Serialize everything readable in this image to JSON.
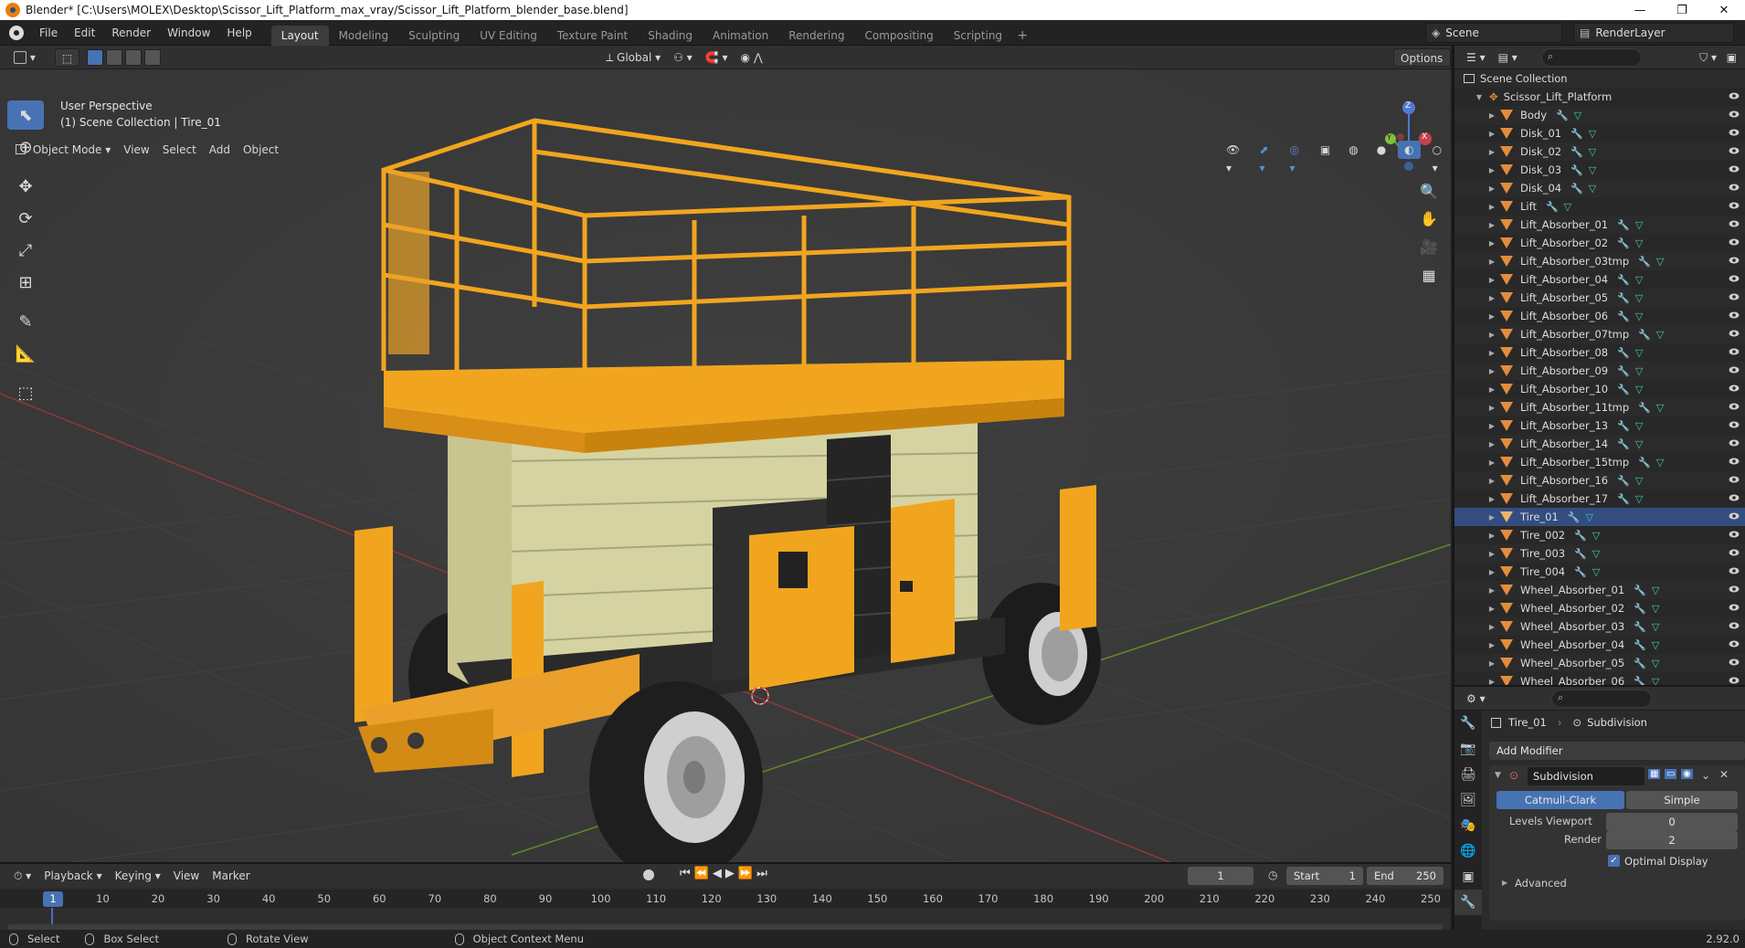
{
  "window": {
    "title": "Blender* [C:\\Users\\MOLEX\\Desktop\\Scissor_Lift_Platform_max_vray/Scissor_Lift_Platform_blender_base.blend]",
    "minimize": "—",
    "maximize": "❐",
    "close": "✕"
  },
  "topbar": {
    "menus": [
      "File",
      "Edit",
      "Render",
      "Window",
      "Help"
    ],
    "workspaces": [
      "Layout",
      "Modeling",
      "Sculpting",
      "UV Editing",
      "Texture Paint",
      "Shading",
      "Animation",
      "Rendering",
      "Compositing",
      "Scripting"
    ],
    "active_workspace": "Layout",
    "add_workspace": "+",
    "scene": "Scene",
    "view_layer": "RenderLayer"
  },
  "viewport_header": {
    "transform_orientation": "Global",
    "options": "Options",
    "mode": "Object Mode",
    "menus": [
      "View",
      "Select",
      "Add",
      "Object"
    ]
  },
  "viewport": {
    "perspective": "User Perspective",
    "collection_info": "(1) Scene Collection | Tire_01",
    "axis_x": "X",
    "axis_y": "Y",
    "axis_z": "Z"
  },
  "outliner": {
    "root": "Scene Collection",
    "collection": "Scissor_Lift_Platform",
    "items": [
      "Body",
      "Disk_01",
      "Disk_02",
      "Disk_03",
      "Disk_04",
      "Lift",
      "Lift_Absorber_01",
      "Lift_Absorber_02",
      "Lift_Absorber_03tmp",
      "Lift_Absorber_04",
      "Lift_Absorber_05",
      "Lift_Absorber_06",
      "Lift_Absorber_07tmp",
      "Lift_Absorber_08",
      "Lift_Absorber_09",
      "Lift_Absorber_10",
      "Lift_Absorber_11tmp",
      "Lift_Absorber_13",
      "Lift_Absorber_14",
      "Lift_Absorber_15tmp",
      "Lift_Absorber_16",
      "Lift_Absorber_17",
      "Tire_01",
      "Tire_002",
      "Tire_003",
      "Tire_004",
      "Wheel_Absorber_01",
      "Wheel_Absorber_02",
      "Wheel_Absorber_03",
      "Wheel_Absorber_04",
      "Wheel_Absorber_05",
      "Wheel_Absorber_06"
    ],
    "selected": "Tire_01"
  },
  "properties": {
    "object": "Tire_01",
    "modifier_context": "Subdivision",
    "add_modifier": "Add Modifier",
    "modifier_name": "Subdivision",
    "algorithm_a": "Catmull-Clark",
    "algorithm_b": "Simple",
    "levels_viewport_label": "Levels Viewport",
    "levels_viewport": "0",
    "render_label": "Render",
    "render_value": "2",
    "optimal_display": "Optimal Display",
    "advanced": "Advanced"
  },
  "timeline": {
    "menus": [
      "Playback",
      "Keying",
      "View",
      "Marker"
    ],
    "current_frame": "1",
    "start_label": "Start",
    "start": "1",
    "end_label": "End",
    "end": "250",
    "ticks": [
      "1",
      "10",
      "20",
      "30",
      "40",
      "50",
      "60",
      "70",
      "80",
      "90",
      "100",
      "110",
      "120",
      "130",
      "140",
      "150",
      "160",
      "170",
      "180",
      "190",
      "200",
      "210",
      "220",
      "230",
      "240",
      "250"
    ]
  },
  "statusbar": {
    "select": "Select",
    "box_select": "Box Select",
    "rotate_view": "Rotate View",
    "context_menu": "Object Context Menu",
    "version": "2.92.0"
  },
  "colors": {
    "accent": "#4772b3",
    "object_orange": "#e38d3c",
    "lift_yellow": "#f1a51f",
    "scissor_cream": "#d9d6a4"
  }
}
